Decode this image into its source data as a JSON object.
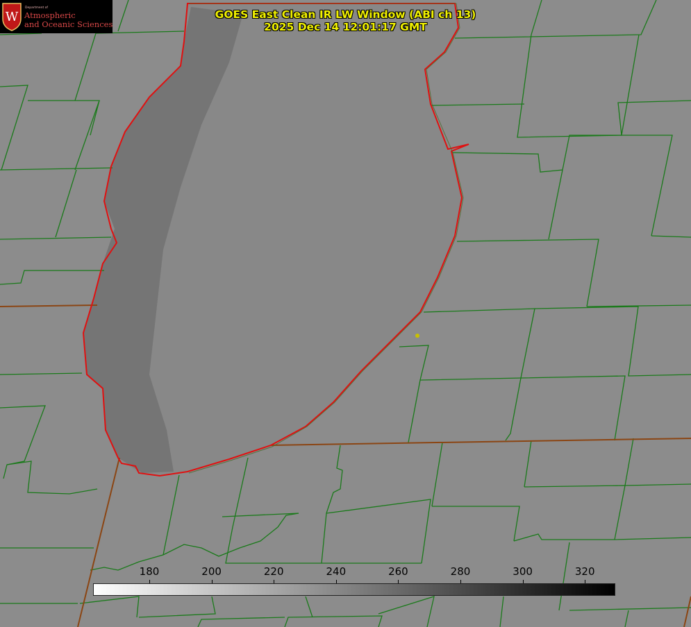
{
  "title": {
    "line1": "GOES East Clean IR LW Window (ABI ch 13)",
    "line2": "2025 Dec 14 12:01:17 GMT"
  },
  "logo": {
    "dept": "Department of",
    "line1": "Atmospheric",
    "line2": "and Oceanic Sciences",
    "seal_letter": "W"
  },
  "colorbar": {
    "ticks": [
      "180",
      "200",
      "220",
      "240",
      "260",
      "280",
      "300",
      "320"
    ],
    "gradient_start": "#ffffff",
    "gradient_end": "#000000"
  },
  "colors": {
    "county_lines": "#1a7a1a",
    "state_lines": "#8b4513",
    "shoreline": "#e01010",
    "title_text": "#f0f000",
    "marker": "#c8c000"
  }
}
